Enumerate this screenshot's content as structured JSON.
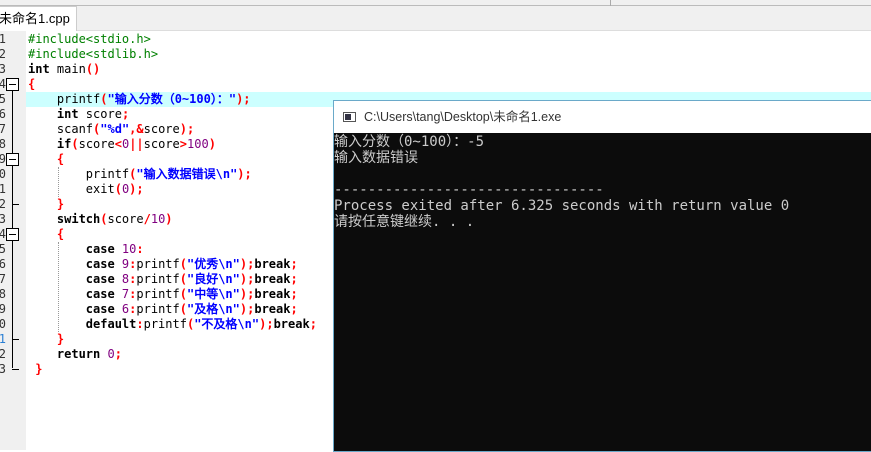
{
  "tab": {
    "label": "未命名1.cpp"
  },
  "editor": {
    "highlight_line": 5,
    "fold_lines": [
      4,
      9,
      14
    ],
    "lines": [
      [
        [
          "#include<stdio.h>",
          "pp"
        ]
      ],
      [
        [
          "#include<stdlib.h>",
          "pp"
        ]
      ],
      [
        [
          "int",
          "kw"
        ],
        [
          " main",
          ""
        ],
        [
          "()",
          "p"
        ]
      ],
      [
        [
          "{",
          "p"
        ]
      ],
      [
        [
          "    printf",
          ""
        ],
        [
          "(",
          "p"
        ],
        [
          "\"输入分数（0~100）：\"",
          "s"
        ],
        [
          ");",
          "p"
        ]
      ],
      [
        [
          "    int",
          "kw"
        ],
        [
          " score",
          ""
        ],
        [
          ";",
          "p"
        ]
      ],
      [
        [
          "    scanf",
          ""
        ],
        [
          "(",
          "p"
        ],
        [
          "\"%d\"",
          "s"
        ],
        [
          ",&",
          "p"
        ],
        [
          "score",
          ""
        ],
        [
          ");",
          "p"
        ]
      ],
      [
        [
          "    if",
          "kw"
        ],
        [
          "(",
          "p"
        ],
        [
          "score",
          ""
        ],
        [
          "<",
          "p"
        ],
        [
          "0",
          "n"
        ],
        [
          "||",
          "p"
        ],
        [
          "score",
          ""
        ],
        [
          ">",
          "p"
        ],
        [
          "100",
          "n"
        ],
        [
          ")",
          "p"
        ]
      ],
      [
        [
          "    {",
          "p"
        ]
      ],
      [
        [
          "        printf",
          ""
        ],
        [
          "(",
          "p"
        ],
        [
          "\"输入数据错误\\n\"",
          "s"
        ],
        [
          ");",
          "p"
        ]
      ],
      [
        [
          "        exit",
          ""
        ],
        [
          "(",
          "p"
        ],
        [
          "0",
          "n"
        ],
        [
          ");",
          "p"
        ]
      ],
      [
        [
          "    }",
          "p"
        ]
      ],
      [
        [
          "    switch",
          "kw"
        ],
        [
          "(",
          "p"
        ],
        [
          "score",
          ""
        ],
        [
          "/",
          "p"
        ],
        [
          "10",
          "n"
        ],
        [
          ")",
          "p"
        ]
      ],
      [
        [
          "    {",
          "p"
        ]
      ],
      [
        [
          "        case",
          "kw"
        ],
        [
          " 10",
          "n"
        ],
        [
          ":",
          "p"
        ]
      ],
      [
        [
          "        case",
          "kw"
        ],
        [
          " 9",
          "n"
        ],
        [
          ":",
          "p"
        ],
        [
          "printf",
          ""
        ],
        [
          "(",
          "p"
        ],
        [
          "\"优秀\\n\"",
          "s"
        ],
        [
          ");",
          "p"
        ],
        [
          "break",
          "kw"
        ],
        [
          ";",
          "p"
        ]
      ],
      [
        [
          "        case",
          "kw"
        ],
        [
          " 8",
          "n"
        ],
        [
          ":",
          "p"
        ],
        [
          "printf",
          ""
        ],
        [
          "(",
          "p"
        ],
        [
          "\"良好\\n\"",
          "s"
        ],
        [
          ");",
          "p"
        ],
        [
          "break",
          "kw"
        ],
        [
          ";",
          "p"
        ]
      ],
      [
        [
          "        case",
          "kw"
        ],
        [
          " 7",
          "n"
        ],
        [
          ":",
          "p"
        ],
        [
          "printf",
          ""
        ],
        [
          "(",
          "p"
        ],
        [
          "\"中等\\n\"",
          "s"
        ],
        [
          ");",
          "p"
        ],
        [
          "break",
          "kw"
        ],
        [
          ";",
          "p"
        ]
      ],
      [
        [
          "        case",
          "kw"
        ],
        [
          " 6",
          "n"
        ],
        [
          ":",
          "p"
        ],
        [
          "printf",
          ""
        ],
        [
          "(",
          "p"
        ],
        [
          "\"及格\\n\"",
          "s"
        ],
        [
          ");",
          "p"
        ],
        [
          "break",
          "kw"
        ],
        [
          ";",
          "p"
        ]
      ],
      [
        [
          "        default",
          "kw"
        ],
        [
          ":",
          "p"
        ],
        [
          "printf",
          ""
        ],
        [
          "(",
          "p"
        ],
        [
          "\"不及格\\n\"",
          "s"
        ],
        [
          ");",
          "p"
        ],
        [
          "break",
          "kw"
        ],
        [
          ";",
          "p"
        ]
      ],
      [
        [
          "    }",
          "p"
        ]
      ],
      [
        [
          "    return",
          "kw"
        ],
        [
          " 0",
          "n"
        ],
        [
          ";",
          "p"
        ]
      ],
      [
        [
          " }",
          "p"
        ]
      ]
    ]
  },
  "console": {
    "title": "C:\\Users\\tang\\Desktop\\未命名1.exe",
    "output": [
      "输入分数（0~100）：-5",
      "输入数据错误",
      "",
      "--------------------------------",
      "Process exited after 6.325 seconds with return value 0",
      "请按任意键继续. . ."
    ]
  }
}
